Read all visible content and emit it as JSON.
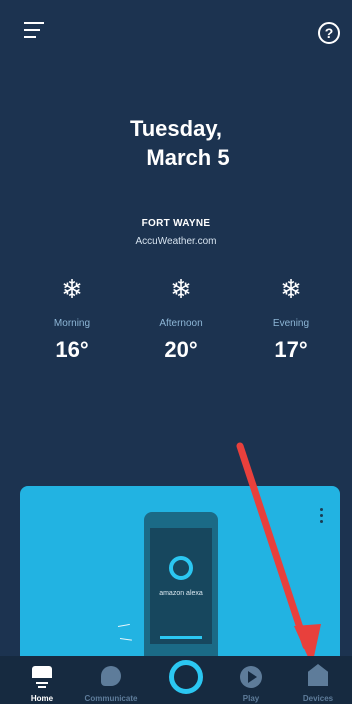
{
  "header": {
    "menu_icon": "hamburger-menu-icon",
    "help_label": "?"
  },
  "date": {
    "line1": "Tuesday,",
    "line2": "March 5"
  },
  "weather": {
    "city": "FORT WAYNE",
    "source": "AccuWeather.com",
    "icon": "snowflake-icon",
    "snow_glyph": "❄",
    "periods": [
      {
        "label": "Morning",
        "temp": "16°"
      },
      {
        "label": "Afternoon",
        "temp": "20°"
      },
      {
        "label": "Evening",
        "temp": "17°"
      }
    ]
  },
  "card": {
    "device_label": "amazon alexa"
  },
  "nav": {
    "items": [
      {
        "label": "Home",
        "icon": "home-icon"
      },
      {
        "label": "Communicate",
        "icon": "chat-bubble-icon"
      },
      {
        "label": "",
        "icon": "alexa-ring-icon"
      },
      {
        "label": "Play",
        "icon": "play-icon"
      },
      {
        "label": "Devices",
        "icon": "devices-house-icon"
      }
    ]
  },
  "colors": {
    "background": "#1c3350",
    "accent": "#2bc7f2",
    "card": "#22b3e2",
    "annotation_arrow": "#e8403c"
  }
}
